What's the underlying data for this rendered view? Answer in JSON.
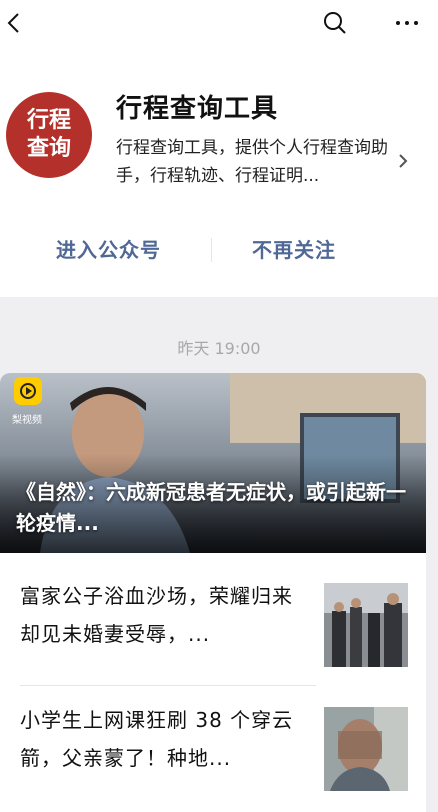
{
  "nav": {
    "back_icon": "chevron-left-icon",
    "search_icon": "search-icon",
    "more_icon": "more-icon"
  },
  "account": {
    "logo_line1": "行程",
    "logo_line2": "查询",
    "logo_color": "#b3312a",
    "name": "行程查询工具",
    "description": "行程查询工具，提供个人行程查询助手，行程轨迹、行程证明..."
  },
  "actions": {
    "enter_label": "进入公众号",
    "unfollow_label": "不再关注",
    "accent_color": "#4f6896"
  },
  "feed": {
    "date_label": "昨天 19:00",
    "hero": {
      "source_label": "梨视频",
      "title": "《自然》：六成新冠患者无症状，或引起新一轮疫情..."
    },
    "items": [
      {
        "title": "富家公子浴血沙场，荣耀归来却见未婚妻受辱，..."
      },
      {
        "title": "小学生上网课狂刷 38 个穿云箭，父亲蒙了！种地..."
      }
    ]
  }
}
